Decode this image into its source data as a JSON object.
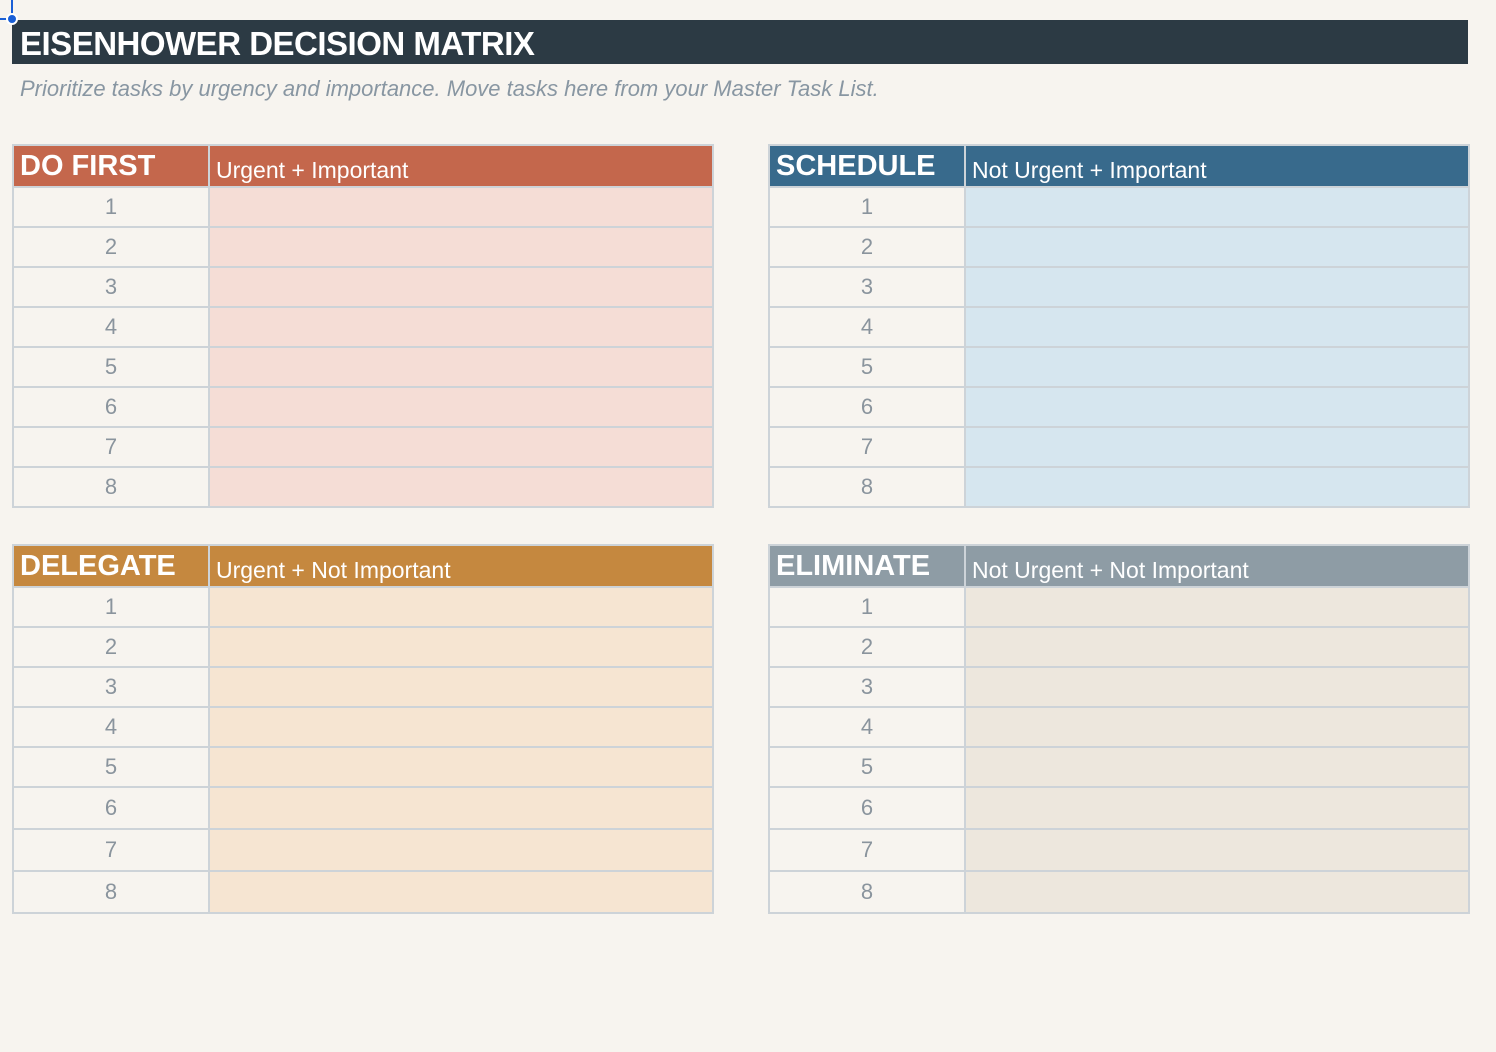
{
  "title": "EISENHOWER DECISION MATRIX",
  "subtitle": "Prioritize tasks by urgency and importance. Move tasks here from your Master Task List.",
  "quadrants": [
    {
      "name": "DO FIRST",
      "description": "Urgent + Important",
      "header_color": "#c4674c",
      "body_color": "#f5ddd6",
      "rows": [
        "1",
        "2",
        "3",
        "4",
        "5",
        "6",
        "7",
        "8"
      ]
    },
    {
      "name": "SCHEDULE",
      "description": "Not Urgent + Important",
      "header_color": "#386a8c",
      "body_color": "#d6e6ef",
      "rows": [
        "1",
        "2",
        "3",
        "4",
        "5",
        "6",
        "7",
        "8"
      ]
    },
    {
      "name": "DELEGATE",
      "description": "Urgent + Not Important",
      "header_color": "#c5883f",
      "body_color": "#f6e5d2",
      "rows": [
        "1",
        "2",
        "3",
        "4",
        "5",
        "6",
        "7",
        "8"
      ]
    },
    {
      "name": "ELIMINATE",
      "description": "Not Urgent + Not Important",
      "header_color": "#8e9ca5",
      "body_color": "#ede7dd",
      "rows": [
        "1",
        "2",
        "3",
        "4",
        "5",
        "6",
        "7",
        "8"
      ]
    }
  ]
}
